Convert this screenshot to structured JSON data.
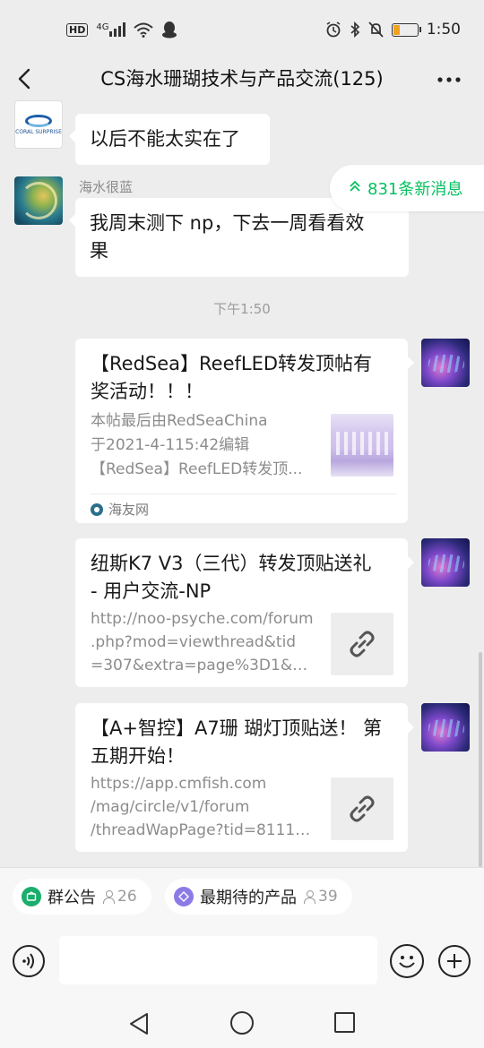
{
  "status_bar": {
    "hd_badge": "HD",
    "network": "4G",
    "time": "1:50",
    "battery_level": 0.25
  },
  "header": {
    "title": "CS海水珊瑚技术与产品交流(125)"
  },
  "new_messages": {
    "label": "831条新消息"
  },
  "messages": [
    {
      "sender": "",
      "avatar_text": "CORAL SURPRISE",
      "text": "以后不能太实在了"
    },
    {
      "sender": "海水很蓝",
      "text_line1": "我周末测下 np，下去一周看看效",
      "text_line2": "果"
    }
  ],
  "timestamp": "下午1:50",
  "cards": [
    {
      "title_line1": "【RedSea】ReefLED转发顶帖有",
      "title_line2": "奖活动！！！",
      "desc_line1": "本帖最后由RedSeaChina",
      "desc_line2": "于2021-4-115:42编辑",
      "desc_line3": "【RedSea】ReefLED转发顶...",
      "source": "海友网"
    },
    {
      "title_line1": "纽斯K7 V3（三代）转发顶贴送礼",
      "title_line2": "- 用户交流-NP",
      "desc_line1": "http://noo-psyche.com/forum",
      "desc_line2": ".php?mod=viewthread&tid",
      "desc_line3": "=307&extra=page%3D1&mo..."
    },
    {
      "title_line1": "【A+智控】A7珊 瑚灯顶贴送！ 第",
      "title_line2": "五期开始！",
      "desc_line1": "https://app.cmfish.com",
      "desc_line2": "/mag/circle/v1/forum",
      "desc_line3": "/threadWapPage?tid=81119..."
    }
  ],
  "pills": [
    {
      "label": "群公告",
      "count": "26",
      "color": "#1aad6b"
    },
    {
      "label": "最期待的产品",
      "count": "39",
      "color": "#8c7ae6"
    }
  ],
  "input": {
    "value": "",
    "placeholder": ""
  }
}
